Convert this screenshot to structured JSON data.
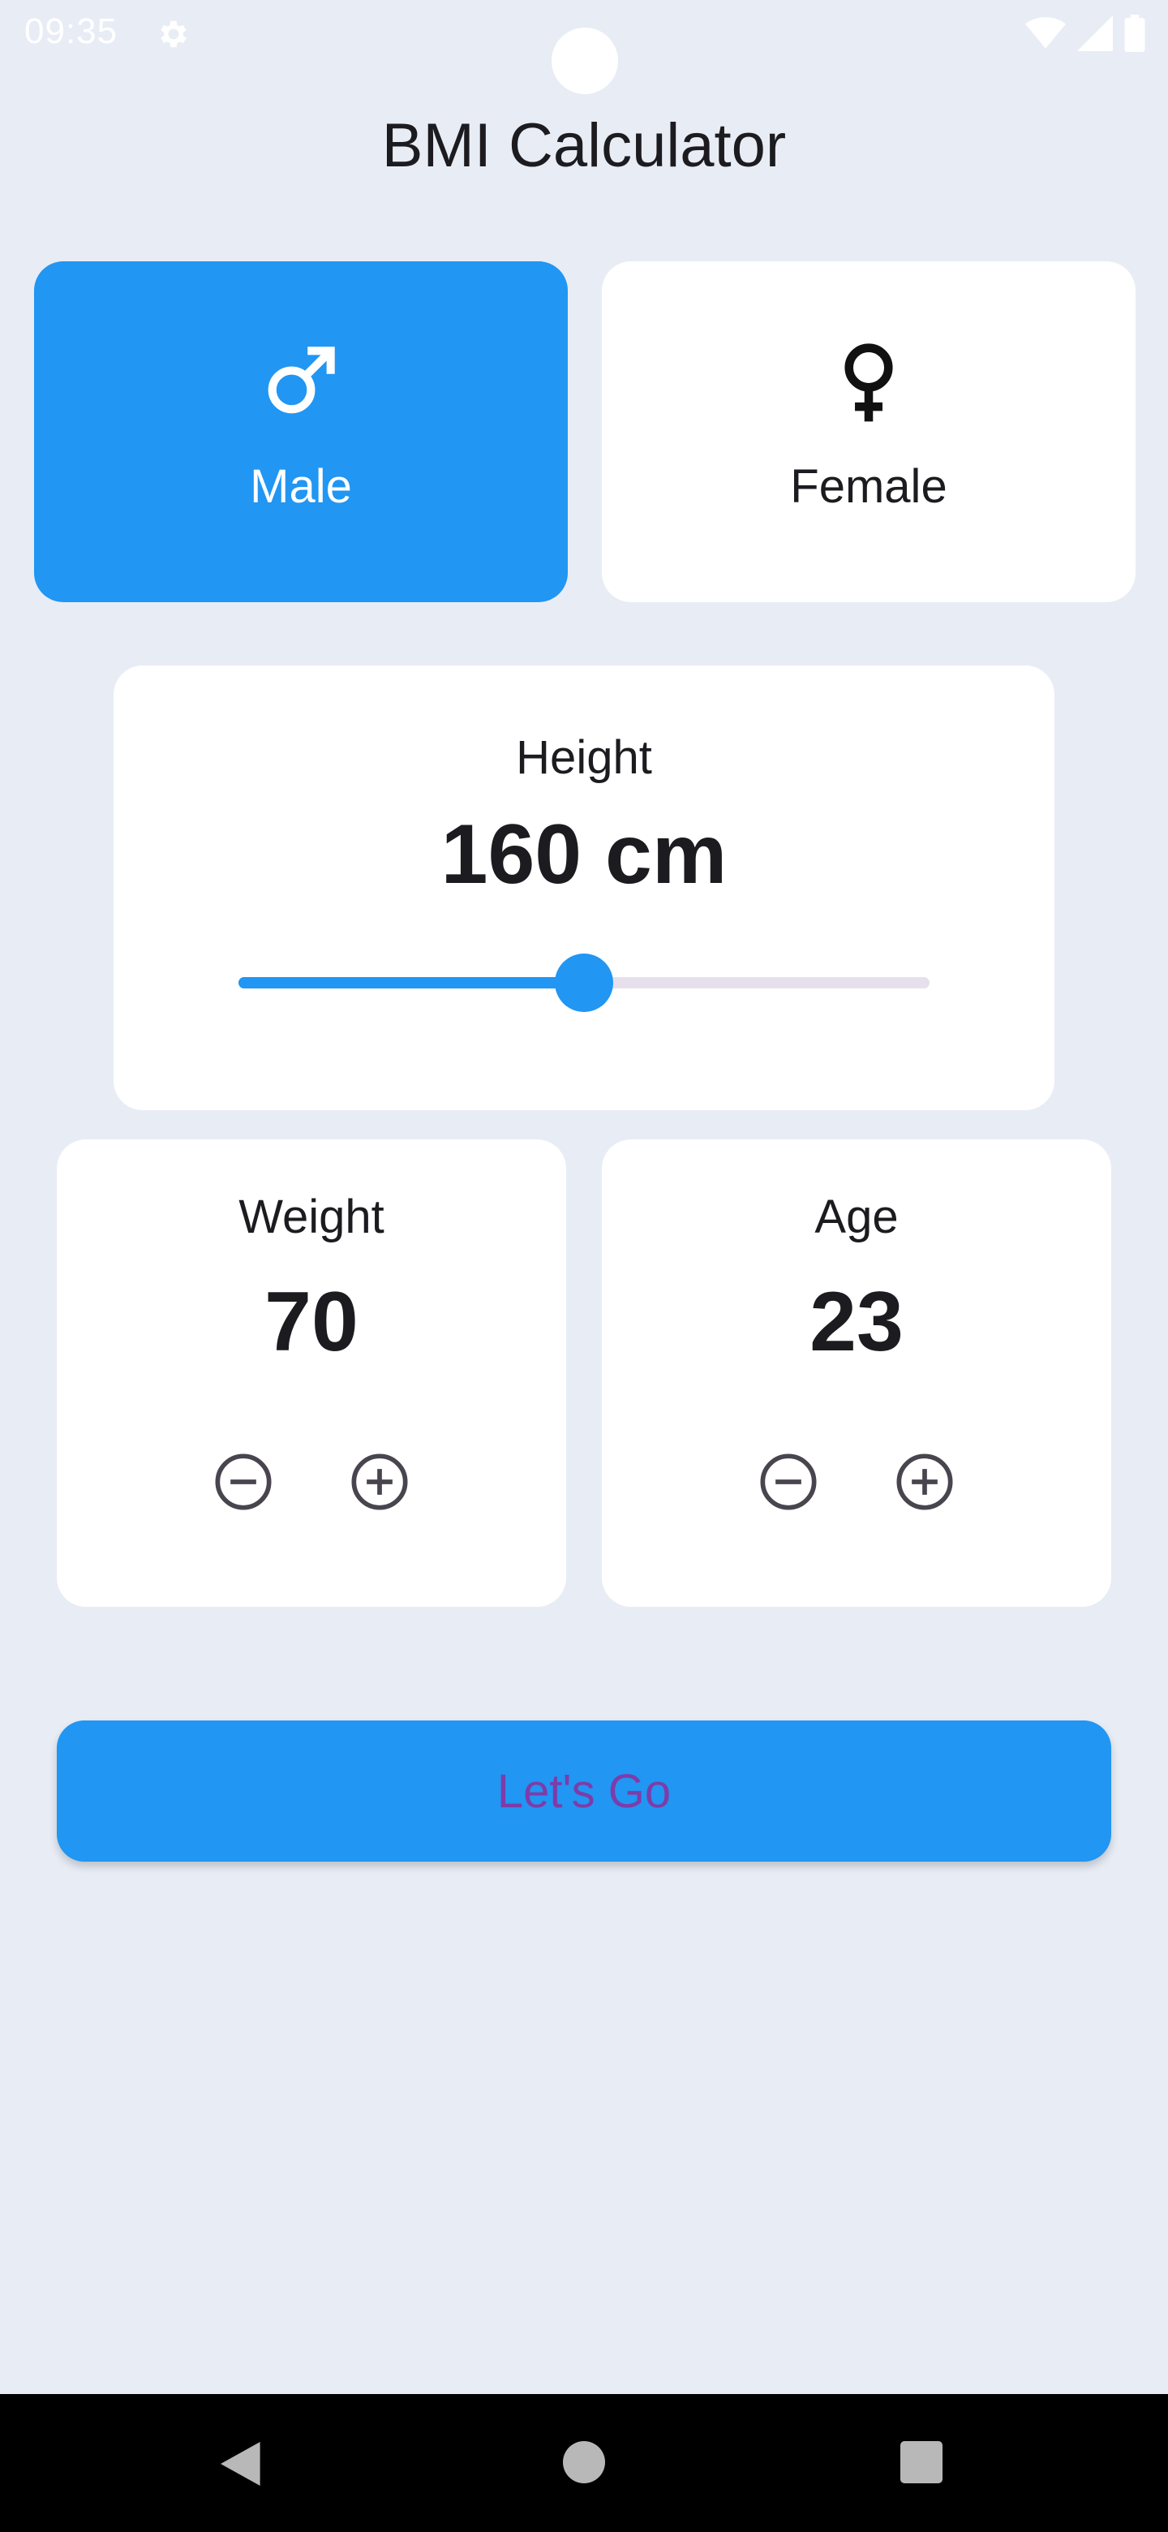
{
  "status_bar": {
    "time": "09:35"
  },
  "app": {
    "title": "BMI Calculator"
  },
  "gender": {
    "male_label": "Male",
    "female_label": "Female",
    "selected": "Male"
  },
  "height": {
    "label": "Height",
    "value_text": "160 cm",
    "slider_fraction": 0.5
  },
  "weight": {
    "label": "Weight",
    "value": "70"
  },
  "age": {
    "label": "Age",
    "value": "23"
  },
  "action": {
    "go_label": "Let's Go"
  },
  "colors": {
    "accent": "#2196f3",
    "background": "#e8ecf5",
    "card": "#ffffff",
    "button_text": "#7e3ca8"
  },
  "icons": [
    "gear-icon",
    "wifi-icon",
    "signal-icon",
    "battery-icon",
    "male-icon",
    "female-icon",
    "minus-circle-icon",
    "plus-circle-icon",
    "back-icon",
    "home-icon",
    "recents-icon"
  ]
}
